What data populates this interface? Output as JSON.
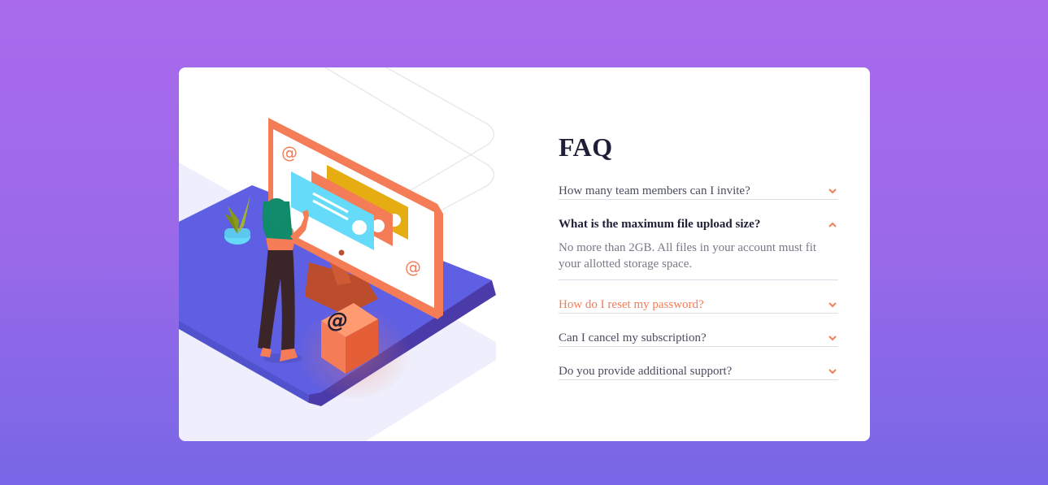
{
  "faq": {
    "title": "FAQ",
    "items": [
      {
        "question": "How many team members can I invite?",
        "state": "collapsed"
      },
      {
        "question": "What is the maximum file upload size?",
        "state": "expanded",
        "answer": "No more than 2GB. All files in your account must fit your allotted storage space."
      },
      {
        "question": "How do I reset my password?",
        "state": "hover"
      },
      {
        "question": "Can I cancel my subscription?",
        "state": "collapsed"
      },
      {
        "question": "Do you provide additional support?",
        "state": "collapsed"
      }
    ]
  },
  "colors": {
    "background_top": "#a96bec",
    "background_bottom": "#7767e6",
    "accent": "#f47c57",
    "title": "#1e1f36",
    "text": "#4b4c5f",
    "answer": "#787887",
    "platform": "#5f5fe3"
  },
  "icons": {
    "chevron": "chevron-down-icon",
    "chevron_open": "chevron-up-icon",
    "box": "at-sign-box-icon"
  }
}
